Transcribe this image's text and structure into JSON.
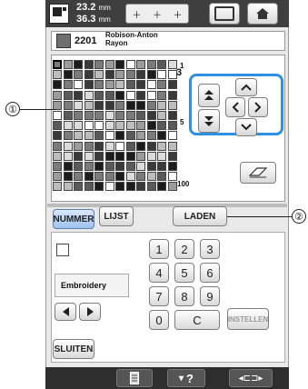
{
  "header": {
    "size_width": "23.2",
    "size_height": "36.3",
    "unit_w": "mm",
    "unit_h": "mm",
    "frame_icon": "embroidery-frame-icon",
    "home_icon": "home-icon"
  },
  "thread": {
    "number": "2201",
    "brand_line1": "Robison-Anton",
    "brand_line2": "Rayon",
    "swatch_color": "#6e6e6e"
  },
  "palette": {
    "row_markers": [
      "1",
      "5",
      "100"
    ],
    "selector_label": "3"
  },
  "tabs": {
    "nummer": "NUMMER",
    "lijst": "LIJST",
    "laden": "LADEN"
  },
  "keypad": {
    "keys": [
      "1",
      "2",
      "3",
      "4",
      "5",
      "6",
      "7",
      "8",
      "9",
      "0",
      "C"
    ],
    "instellen": "INSTELLEN"
  },
  "left_panel": {
    "category": "Embroidery"
  },
  "bottom": {
    "close": "SLUITEN",
    "help": "?"
  },
  "callouts": {
    "one": "①",
    "two": "②"
  }
}
